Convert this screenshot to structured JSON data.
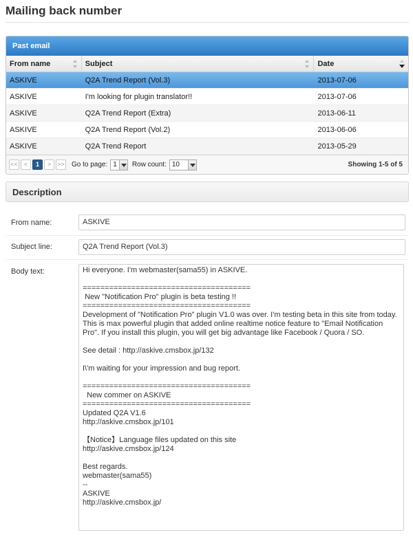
{
  "page": {
    "title": "Mailing back number"
  },
  "grid": {
    "caption": "Past email",
    "columns": [
      {
        "label": "From name"
      },
      {
        "label": "Subject"
      },
      {
        "label": "Date"
      }
    ],
    "rows": [
      {
        "from": "ASKIVE",
        "subject": "Q2A Trend Report (Vol.3)",
        "date": "2013-07-06",
        "selected": true
      },
      {
        "from": "ASKIVE",
        "subject": "I'm looking for plugin translator!!",
        "date": "2013-07-06"
      },
      {
        "from": "ASKIVE",
        "subject": "Q2A Trend Report (Extra)",
        "date": "2013-06-11"
      },
      {
        "from": "ASKIVE",
        "subject": "Q2A Trend Report (Vol.2)",
        "date": "2013-06-06"
      },
      {
        "from": "ASKIVE",
        "subject": "Q2A Trend Report",
        "date": "2013-05-29"
      }
    ],
    "pager": {
      "first": "<<",
      "prev": "<",
      "current_page": "1",
      "next": ">",
      "last": ">>",
      "goto_label": "Go to page:",
      "goto_value": "1",
      "rowcount_label": "Row count:",
      "rowcount_value": "10",
      "showing": "Showing 1-5 of 5"
    }
  },
  "description": {
    "header": "Description",
    "from_label": "From name:",
    "from_value": "ASKIVE",
    "subject_label": "Subject line:",
    "subject_value": "Q2A Trend Report (Vol.3)",
    "body_label": "Body text:",
    "body_value": "Hi everyone. I'm webmaster(sama55) in ASKIVE.\n\n======================================\n New \"Notification Pro\" plugin is beta testing !!\n======================================\nDevelopment of \"Notification Pro\" plugin V1.0 was over. I'm testing beta in this site from today. This is max powerful plugin that added online realtime notice feature to \"Email Notification Pro\". If you install this plugin, you will get big advantage like Facebook / Quora / SO.\n\nSee detail : http://askive.cmsbox.jp/132\n\nI\\'m waiting for your impression and bug report.\n\n======================================\n  New commer on ASKIVE\n======================================\nUpdated Q2A V1.6\nhttp://askive.cmsbox.jp/101\n\n【Notice】Language files updated on this site\nhttp://askive.cmsbox.jp/124\n\nBest regards.\nwebmaster(sama55)\n--\nASKIVE\nhttp://askive.cmsbox.jp/"
  }
}
